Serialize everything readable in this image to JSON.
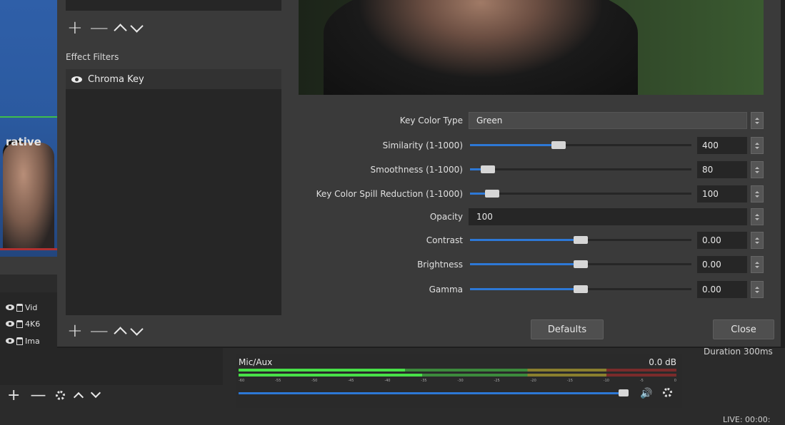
{
  "dialog": {
    "effect_filters_label": "Effect Filters",
    "filters": [
      {
        "name": "Chroma Key",
        "visible_icon": "eye-icon"
      }
    ],
    "toolbar": {
      "add": "+",
      "remove": "—",
      "icons": [
        "plus-icon",
        "minus-icon",
        "chevron-up-icon",
        "chevron-down-icon"
      ]
    },
    "properties": {
      "key_color_type": {
        "label": "Key Color Type",
        "value": "Green"
      },
      "similarity": {
        "label": "Similarity (1-1000)",
        "value": "400",
        "fraction": 0.4
      },
      "smoothness": {
        "label": "Smoothness (1-1000)",
        "value": "80",
        "fraction": 0.08
      },
      "spill": {
        "label": "Key Color Spill Reduction (1-1000)",
        "value": "100",
        "fraction": 0.1
      },
      "opacity": {
        "label": "Opacity",
        "value": "100"
      },
      "contrast": {
        "label": "Contrast",
        "value": "0.00",
        "fraction": 0.5
      },
      "brightness": {
        "label": "Brightness",
        "value": "0.00",
        "fraction": 0.5
      },
      "gamma": {
        "label": "Gamma",
        "value": "0.00",
        "fraction": 0.5
      }
    },
    "buttons": {
      "defaults": "Defaults",
      "close": "Close"
    }
  },
  "background": {
    "preview_text": "rative",
    "sources": [
      "Vid",
      "4K6",
      "Ima"
    ],
    "mixer": {
      "label": "Mic/Aux",
      "db": "0.0 dB",
      "level_fraction": 0.93
    },
    "duration": "Duration  300ms",
    "live": "LIVE: 00:00:"
  },
  "colors": {
    "accent": "#2d78d6",
    "meter_green": "#48e048",
    "dialog_bg": "#3a3a3a",
    "list_bg": "#262626"
  }
}
